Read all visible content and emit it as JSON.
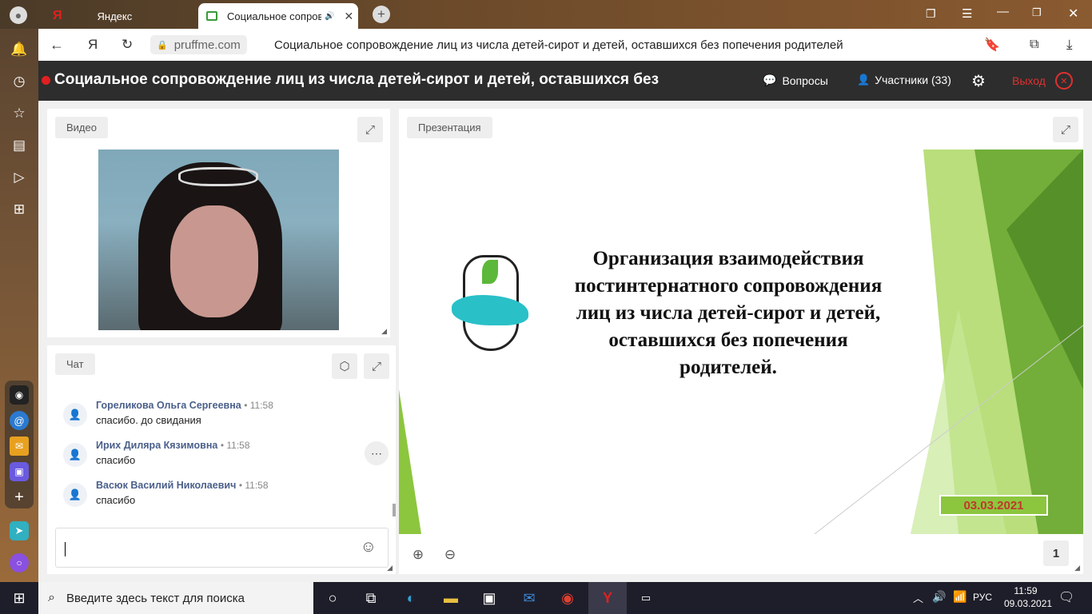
{
  "browser": {
    "tab1_title": "Яндекс",
    "tab2_title": "Социальное сопров",
    "domain": "pruffme.com",
    "page_title": "Социальное сопровождение лиц из числа детей-сирот и детей, оставшихся без попечения родителей"
  },
  "header": {
    "title": "Социальное сопровождение лиц из числа детей-сирот и детей, оставшихся без",
    "questions_label": "Вопросы",
    "participants_label": "Участники (33)",
    "exit_label": "Выход",
    "live_color": "#e02020"
  },
  "video": {
    "label": "Видео"
  },
  "chat": {
    "label": "Чат",
    "messages": [
      {
        "name": "Гореликова Ольга Сергеевна",
        "time": "• 11:58",
        "text": "спасибо. до свидания"
      },
      {
        "name": "Ирих Диляра Кязимовна",
        "time": "• 11:58",
        "text": "спасибо"
      },
      {
        "name": "Васюк Василий Николаевич",
        "time": "• 11:58",
        "text": "спасибо"
      }
    ],
    "input_value": ""
  },
  "presentation": {
    "label": "Презентация",
    "slide_title_lines": [
      "Организация взаимодействия",
      "постинтернатного сопровождения",
      "лиц из числа детей-сирот и детей,",
      "оставшихся без попечения",
      "родителей."
    ],
    "slide_date": "03.03.2021",
    "page_number": "1"
  },
  "taskbar": {
    "search_placeholder": "Введите здесь текст для поиска",
    "lang": "РУС",
    "time": "11:59",
    "date": "09.03.2021"
  }
}
